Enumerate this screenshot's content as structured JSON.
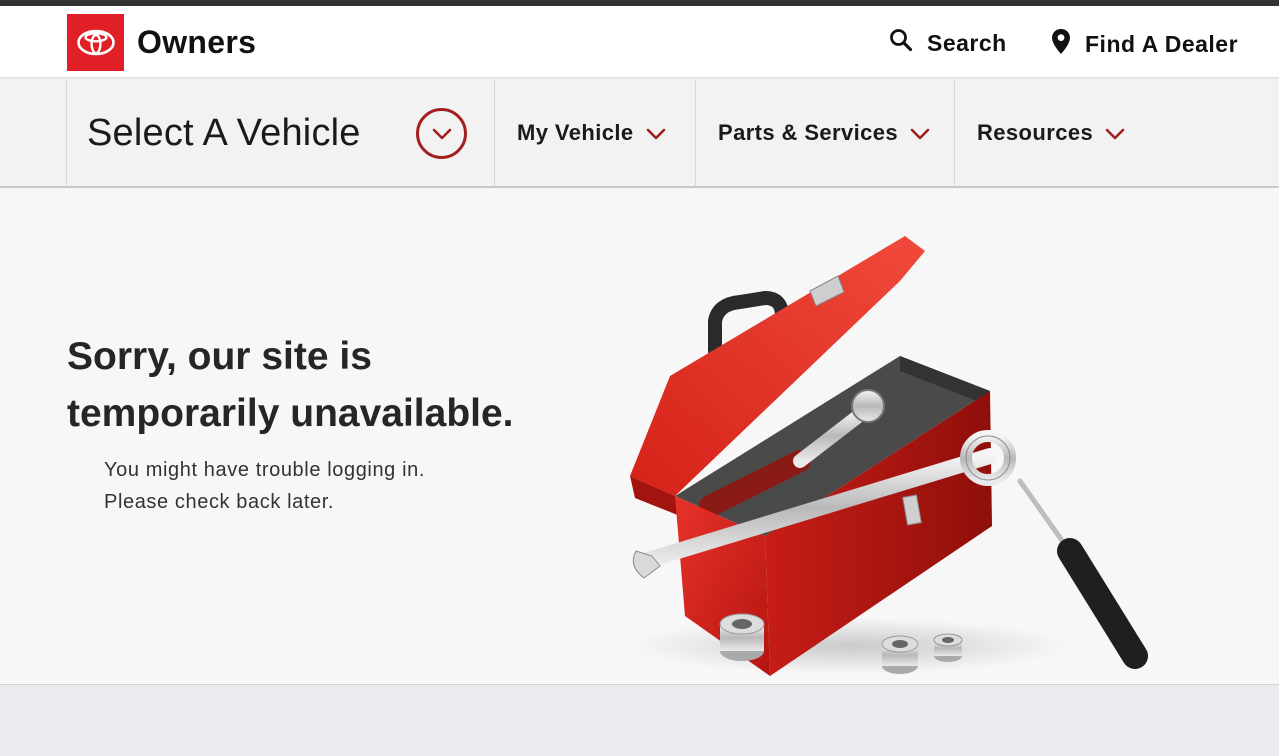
{
  "header": {
    "brand": "Owners",
    "search_label": "Search",
    "dealer_label": "Find A Dealer"
  },
  "nav": {
    "select_vehicle": "Select A Vehicle",
    "items": [
      {
        "label": "My Vehicle"
      },
      {
        "label": "Parts & Services"
      },
      {
        "label": "Resources"
      }
    ]
  },
  "main": {
    "headline_line1": "Sorry, our site is",
    "headline_line2": "temporarily unavailable.",
    "message_line1": "You might have trouble logging in.",
    "message_line2": "Please check back later."
  },
  "colors": {
    "brand_red": "#e01f26",
    "accent_dark_red": "#a31f1f",
    "nav_bg": "#f2f2f2",
    "content_bg": "#f7f7f7",
    "footer_bg": "#ebebef"
  },
  "icons": [
    "toyota-logo-icon",
    "search-icon",
    "location-pin-icon",
    "chevron-down-icon",
    "toolbox-illustration"
  ]
}
